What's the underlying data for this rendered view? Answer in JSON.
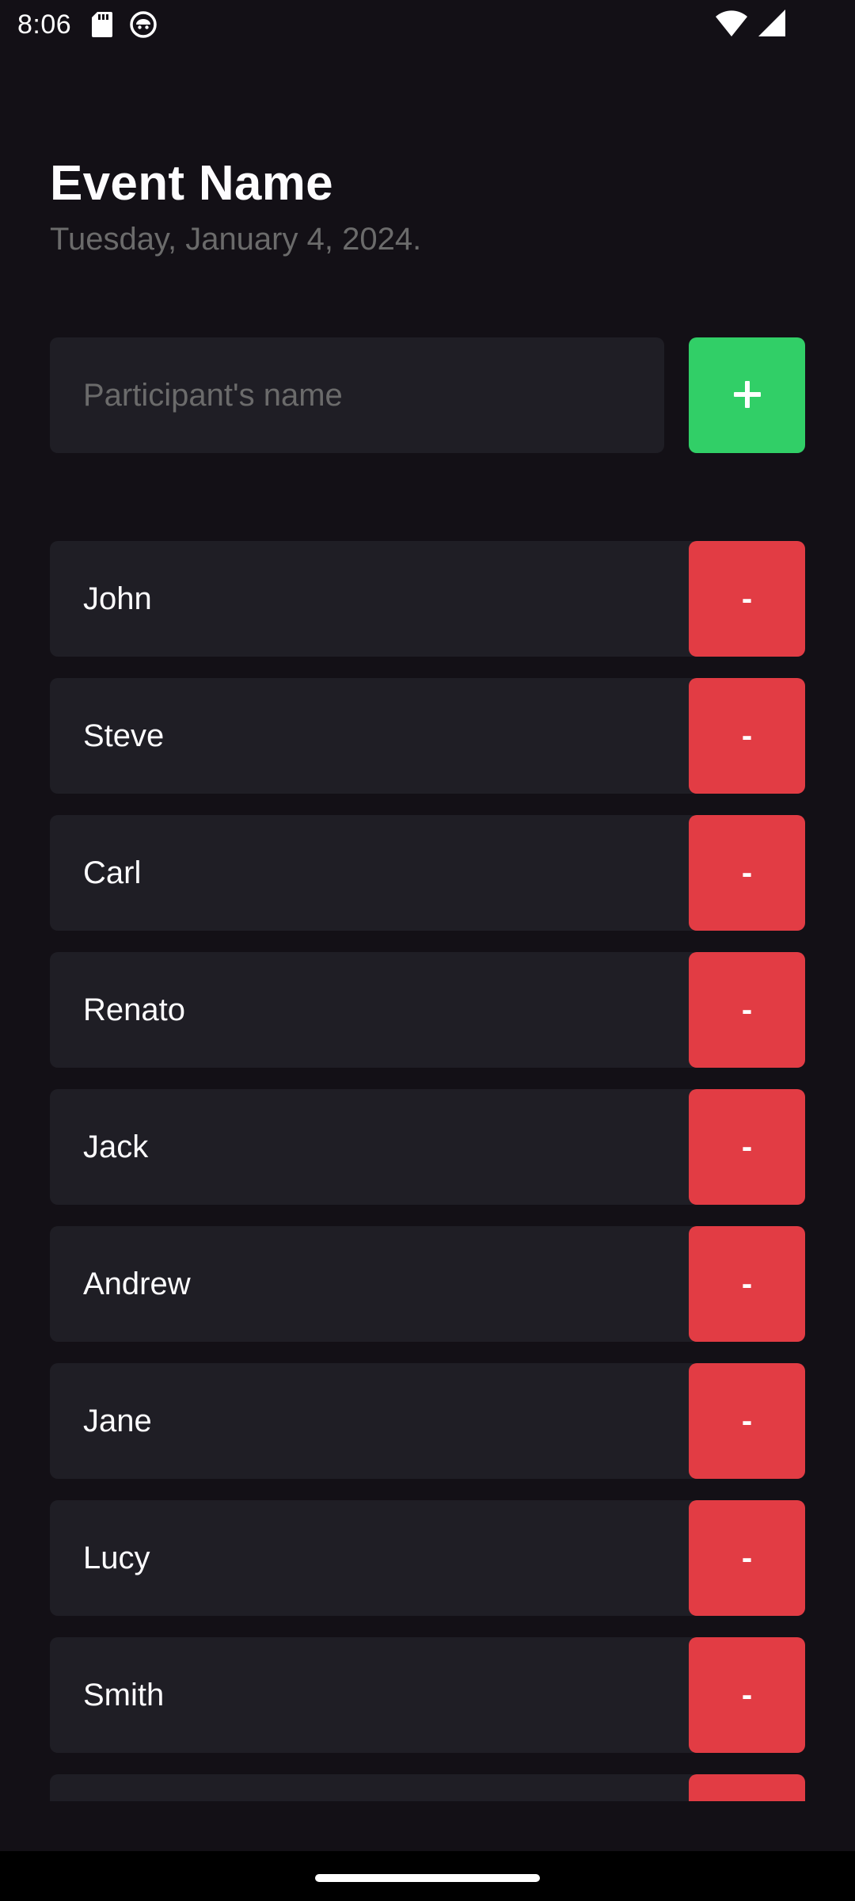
{
  "status_bar": {
    "time": "8:06",
    "icons": [
      "sd-card-icon",
      "app-notification-icon",
      "wifi-icon",
      "signal-icon"
    ]
  },
  "header": {
    "title": "Event Name",
    "date": "Tuesday, January 4, 2024."
  },
  "form": {
    "placeholder": "Participant's name",
    "value": "",
    "add_label": "+"
  },
  "participants": [
    {
      "name": "John",
      "remove_label": "-"
    },
    {
      "name": "Steve",
      "remove_label": "-"
    },
    {
      "name": "Carl",
      "remove_label": "-"
    },
    {
      "name": "Renato",
      "remove_label": "-"
    },
    {
      "name": "Jack",
      "remove_label": "-"
    },
    {
      "name": "Andrew",
      "remove_label": "-"
    },
    {
      "name": "Jane",
      "remove_label": "-"
    },
    {
      "name": "Lucy",
      "remove_label": "-"
    },
    {
      "name": "Smith",
      "remove_label": "-"
    },
    {
      "name": "",
      "remove_label": "-"
    }
  ],
  "colors": {
    "background": "#131016",
    "surface": "#1F1E25",
    "text": "#FDFCFE",
    "muted_text": "#6B6B6B",
    "add_button": "#31CF67",
    "remove_button": "#E23C44"
  }
}
